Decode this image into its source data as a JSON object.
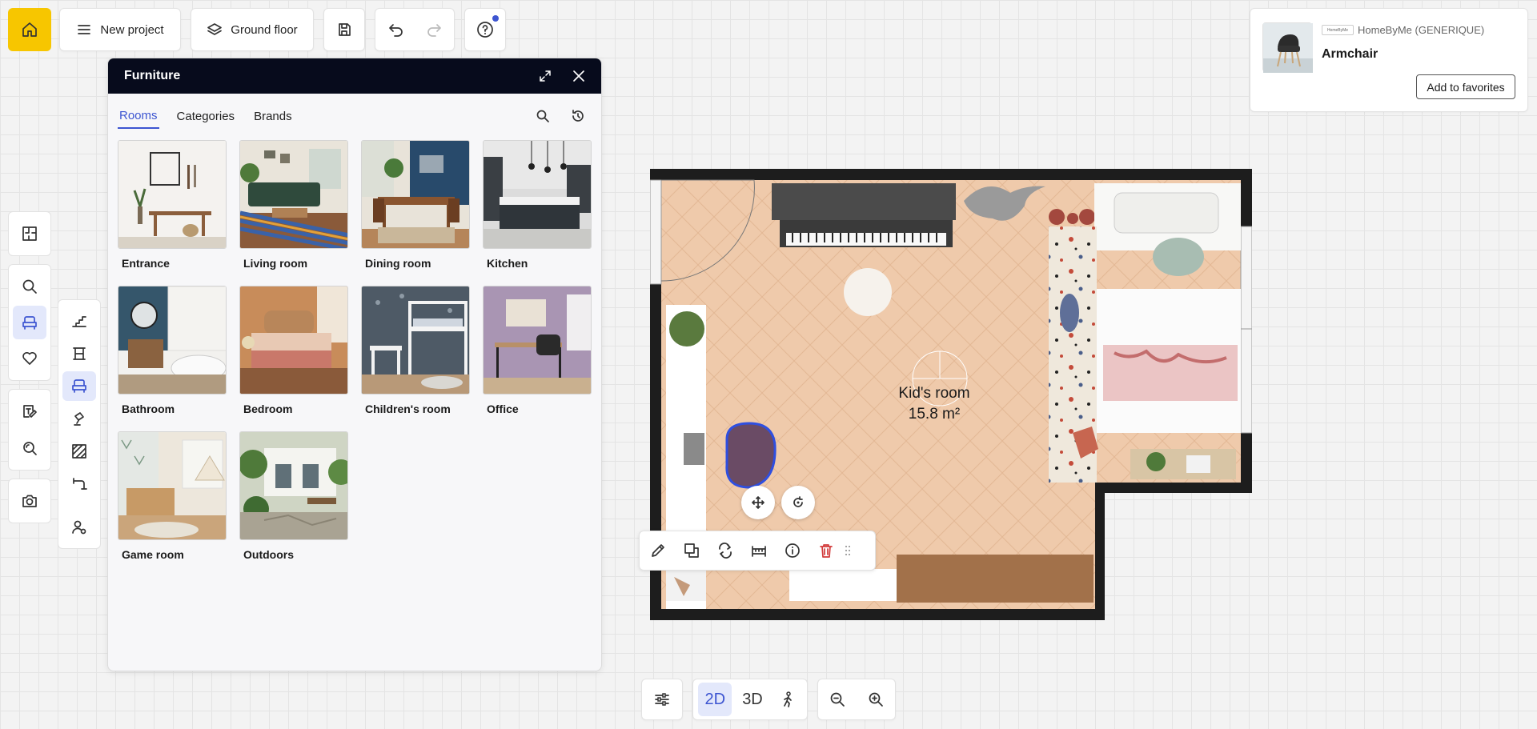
{
  "toolbar": {
    "new_project_label": "New project",
    "floor_label": "Ground floor"
  },
  "panel": {
    "title": "Furniture",
    "tabs": [
      {
        "label": "Rooms",
        "active": true
      },
      {
        "label": "Categories",
        "active": false
      },
      {
        "label": "Brands",
        "active": false
      }
    ],
    "rooms": [
      {
        "label": "Entrance"
      },
      {
        "label": "Living room"
      },
      {
        "label": "Dining room"
      },
      {
        "label": "Kitchen"
      },
      {
        "label": "Bathroom"
      },
      {
        "label": "Bedroom"
      },
      {
        "label": "Children's room"
      },
      {
        "label": "Office"
      },
      {
        "label": "Game room"
      },
      {
        "label": "Outdoors"
      }
    ]
  },
  "product": {
    "brand": "HomeByMe (GENERIQUE)",
    "name": "Armchair",
    "favorites_label": "Add to favorites"
  },
  "plan": {
    "room_name": "Kid's room",
    "room_area": "15.8 m²"
  },
  "view": {
    "mode_2d": "2D",
    "mode_3d": "3D"
  },
  "colors": {
    "accent": "#3d55d1",
    "home": "#f7c600",
    "panel_header": "#070b1c",
    "delete": "#d23a3a",
    "floor": "#ecc6a7",
    "wall": "#1d1d1d"
  }
}
